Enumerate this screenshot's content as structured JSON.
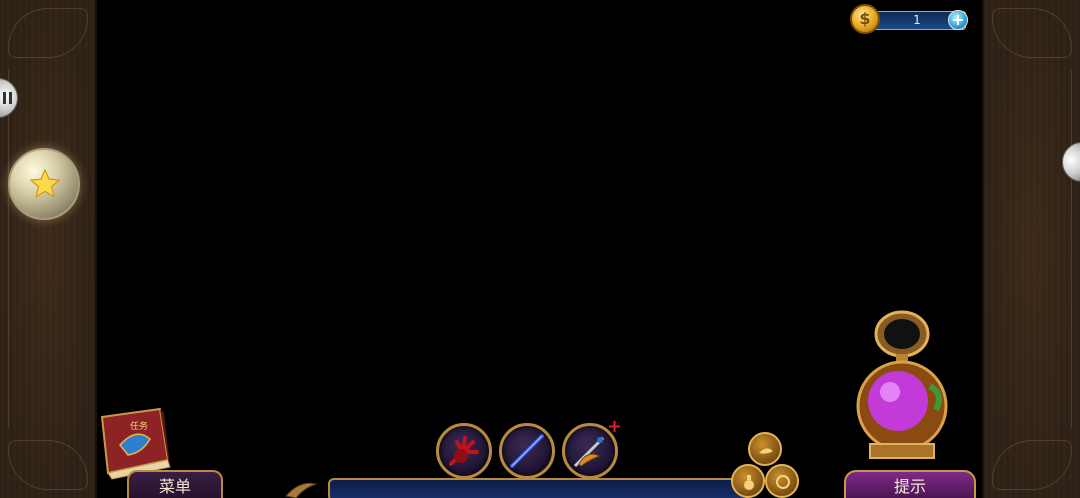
{
  "hud": {
    "coins": "1",
    "coin_symbol": "$",
    "coin_add_symbol": "+",
    "menu_label": "菜单",
    "hint_label": "提示",
    "task_book_label": "任务",
    "new_item_marker": "+"
  },
  "inventory": {
    "items": [
      {
        "name": "red-claw-glove",
        "icon": "claw-icon"
      },
      {
        "name": "blue-wand",
        "icon": "wand-icon"
      },
      {
        "name": "winged-dagger",
        "icon": "dagger-icon"
      }
    ]
  },
  "colors": {
    "frame_gold": "#b88b3c",
    "hint_purple": "#7d2a86",
    "inventory_blue": "#182f6a",
    "menu_purple": "#3a1e46",
    "panel_brown": "#2d2016"
  }
}
